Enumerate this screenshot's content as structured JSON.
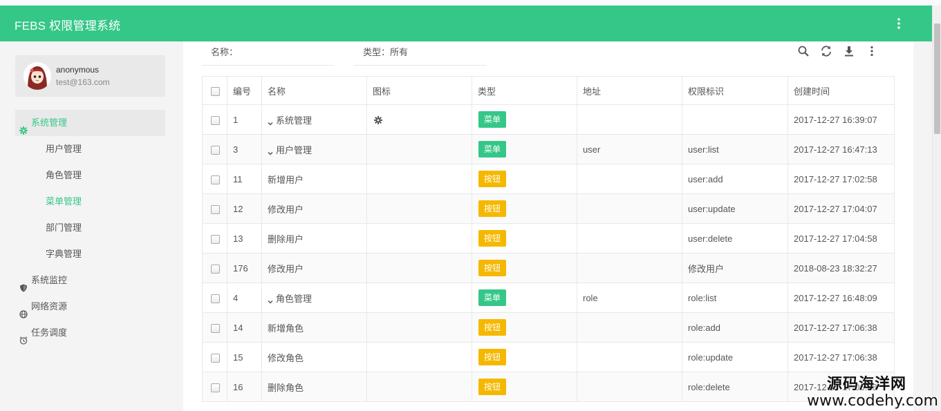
{
  "app": {
    "title": "FEBS 权限管理系统"
  },
  "user": {
    "name": "anonymous",
    "email": "test@163.com"
  },
  "sidebar": {
    "groups": [
      {
        "label": "系统管理",
        "icon": "gear-icon"
      },
      {
        "label": "系统监控",
        "icon": "shield-icon"
      },
      {
        "label": "网络资源",
        "icon": "globe-icon"
      },
      {
        "label": "任务调度",
        "icon": "clock-icon"
      }
    ],
    "sub_items": [
      "用户管理",
      "角色管理",
      "菜单管理",
      "部门管理",
      "字典管理"
    ],
    "active_item": "菜单管理"
  },
  "filters": {
    "name_label": "名称：",
    "type_label": "类型：",
    "type_value": "所有"
  },
  "toolbar": {
    "icons": [
      "search-icon",
      "refresh-icon",
      "download-icon",
      "more-icon"
    ]
  },
  "table": {
    "columns": [
      "编号",
      "名称",
      "图标",
      "类型",
      "地址",
      "权限标识",
      "创建时间"
    ],
    "rows": [
      {
        "id": "1",
        "name": "系统管理",
        "icon": "gear-icon",
        "type": "菜单",
        "url": "",
        "perms": "",
        "created": "2017-12-27 16:39:07"
      },
      {
        "id": "3",
        "name": "用户管理",
        "icon": "",
        "type": "菜单",
        "url": "user",
        "perms": "user:list",
        "created": "2017-12-27 16:47:13"
      },
      {
        "id": "11",
        "name": "新增用户",
        "icon": "",
        "type": "按钮",
        "url": "",
        "perms": "user:add",
        "created": "2017-12-27 17:02:58"
      },
      {
        "id": "12",
        "name": "修改用户",
        "icon": "",
        "type": "按钮",
        "url": "",
        "perms": "user:update",
        "created": "2017-12-27 17:04:07"
      },
      {
        "id": "13",
        "name": "删除用户",
        "icon": "",
        "type": "按钮",
        "url": "",
        "perms": "user:delete",
        "created": "2017-12-27 17:04:58"
      },
      {
        "id": "176",
        "name": "修改用户",
        "icon": "",
        "type": "按钮",
        "url": "",
        "perms": "修改用户",
        "created": "2018-08-23 18:32:27"
      },
      {
        "id": "4",
        "name": "角色管理",
        "icon": "",
        "type": "菜单",
        "url": "role",
        "perms": "role:list",
        "created": "2017-12-27 16:48:09"
      },
      {
        "id": "14",
        "name": "新增角色",
        "icon": "",
        "type": "按钮",
        "url": "",
        "perms": "role:add",
        "created": "2017-12-27 17:06:38"
      },
      {
        "id": "15",
        "name": "修改角色",
        "icon": "",
        "type": "按钮",
        "url": "",
        "perms": "role:update",
        "created": "2017-12-27 17:06:38"
      },
      {
        "id": "16",
        "name": "删除角色",
        "icon": "",
        "type": "按钮",
        "url": "",
        "perms": "role:delete",
        "created": "2017-12-27 17:06:38"
      }
    ]
  },
  "watermark": {
    "line1": "源码海洋网",
    "line2": "www.codehy.com"
  },
  "colors": {
    "brand": "#35c788",
    "button_tag": "#f5b800"
  }
}
